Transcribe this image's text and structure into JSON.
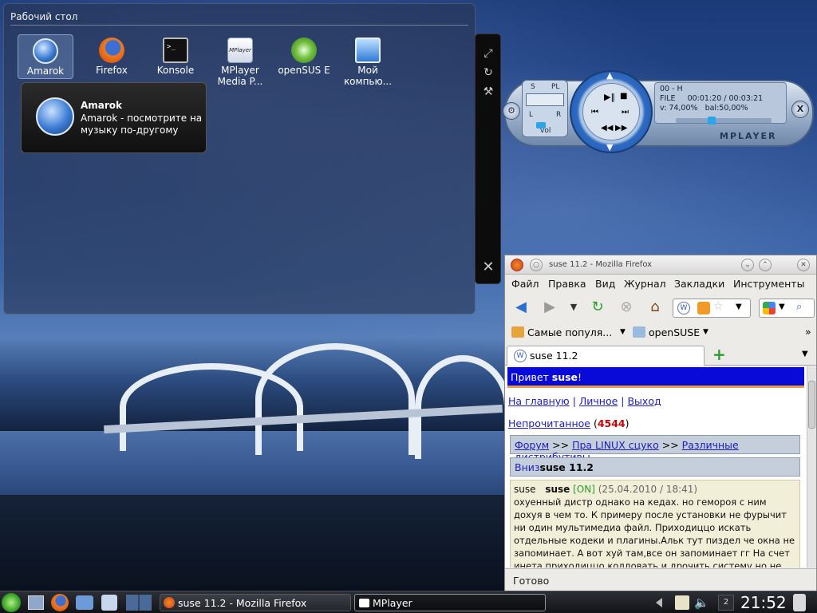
{
  "folderview": {
    "title": "Рабочий стол",
    "icons": [
      {
        "label": "Amarok"
      },
      {
        "label": "Firefox"
      },
      {
        "label": "Konsole"
      },
      {
        "label": "MPlayer Media P..."
      },
      {
        "label": "openSUS E"
      },
      {
        "label": "Мой компью..."
      }
    ],
    "tooltip": {
      "title": "Amarok",
      "body": "Amarok - посмотрите на музыку по-другому"
    }
  },
  "mplayer": {
    "track": "00 - H",
    "file_label": "FILE",
    "time": "00:01:20 / 00:03:21",
    "volume": "v: 74,00%",
    "balance": "bal:50,00%",
    "brand": "MPLAYER",
    "left_labels": [
      "S",
      "PL",
      "L",
      "R",
      "vol"
    ],
    "close_label": "X"
  },
  "firefox": {
    "title": "suse 11.2 - Mozilla Firefox",
    "menu": [
      "Файл",
      "Правка",
      "Вид",
      "Журнал",
      "Закладки",
      "Инструменты"
    ],
    "bookmarks": [
      "Самые популя...",
      "openSUSE"
    ],
    "tab_label": "suse 11.2",
    "status": "Готово",
    "page": {
      "greeting_prefix": "Привет ",
      "greeting_user": "suse",
      "greeting_suffix": "!",
      "links": [
        "На главную",
        "Личное",
        "Выход"
      ],
      "unread_label": "Непрочитанное",
      "unread_count": "4544",
      "crumb": [
        "Форум",
        "Пра LINUX сцуко",
        "Различные дистрибутивы"
      ],
      "crumb_sep": ">>",
      "topic_prefix": "Вниз",
      "topic_title": "suse 11.2",
      "post_author_left": "suse",
      "post_author": "suse",
      "post_status": "[ON]",
      "post_date": "(25.04.2010 / 18:41)",
      "post_text": "охуенный дистр однако на кедах. но гемороя с ним дохуя в чем то. К примеру после установки не фурычит ни один мультимедиа файл. Приходиццо искать отдельные кодеки и плагины.Альк тут пиздел че окна не запоминает. А вот хуй там,все он запоминает гг На счет инета,приходиццо колдовать и дрочить систему,но не сложно в принципе."
    }
  },
  "taskbar": {
    "tasks": [
      "suse 11.2 - Mozilla Firefox",
      "MPlayer"
    ],
    "desktop_num": "2",
    "clock": "21:52"
  },
  "colors": {
    "greet_bar": "#0a0ad8",
    "link": "#1d1dbf",
    "unread": "#cc0000"
  }
}
